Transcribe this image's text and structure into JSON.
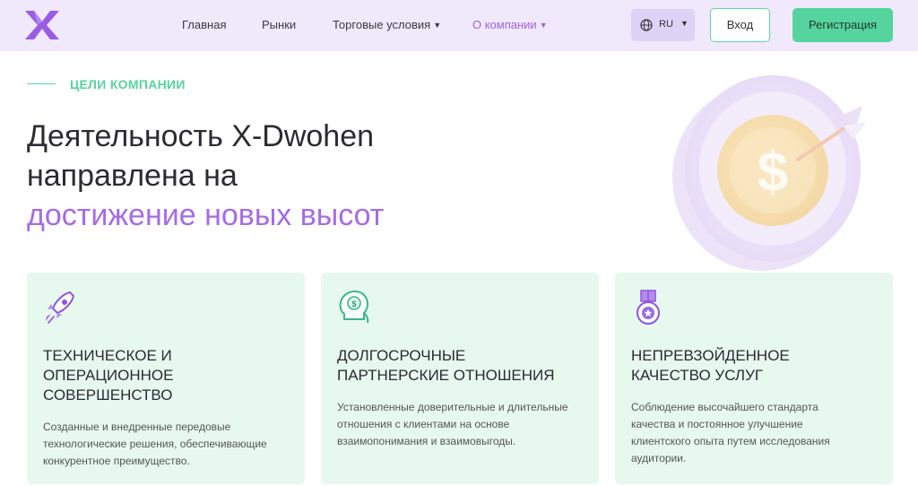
{
  "header": {
    "nav": [
      {
        "label": "Главная"
      },
      {
        "label": "Рынки"
      },
      {
        "label": "Торговые условия"
      },
      {
        "label": "О компании"
      }
    ],
    "language": "RU",
    "login_label": "Вход",
    "register_label": "Регистрация"
  },
  "hero": {
    "eyebrow": "ЦЕЛИ КОМПАНИИ",
    "title_line1": "Деятельность X-Dwohen",
    "title_line2": "направлена на",
    "title_accent": "достижение новых высот"
  },
  "cards": [
    {
      "icon": "rocket-icon",
      "title_lines": [
        "ТЕХНИЧЕСКОЕ И",
        "ОПЕРАЦИОННОЕ",
        "СОВЕРШЕНСТВО"
      ],
      "desc_lines": [
        "Созданные и внедренные передовые",
        "технологические решения, обеспечивающие",
        "конкурентное преимущество."
      ]
    },
    {
      "icon": "head-dollar-icon",
      "title_lines": [
        "ДОЛГОСРОЧНЫЕ",
        "ПАРТНЕРСКИЕ ОТНОШЕНИЯ"
      ],
      "desc_lines": [
        "Установленные доверительные и длительные",
        "отношения с клиентами на основе",
        "взаимопонимания и взаимовыгоды."
      ]
    },
    {
      "icon": "medal-icon",
      "title_lines": [
        "НЕПРЕВЗОЙДЕННОЕ",
        "КАЧЕСТВО УСЛУГ"
      ],
      "desc_lines": [
        "Соблюдение высочайшего стандарта",
        "качества и постоянное улучшение",
        "клиентского опыта путем исследования",
        "аудитории."
      ]
    }
  ],
  "colors": {
    "header_bg": "#efe9fb",
    "accent_purple": "#a66be8",
    "accent_green": "#55d49d",
    "card_bg": "#e7f8ef"
  }
}
